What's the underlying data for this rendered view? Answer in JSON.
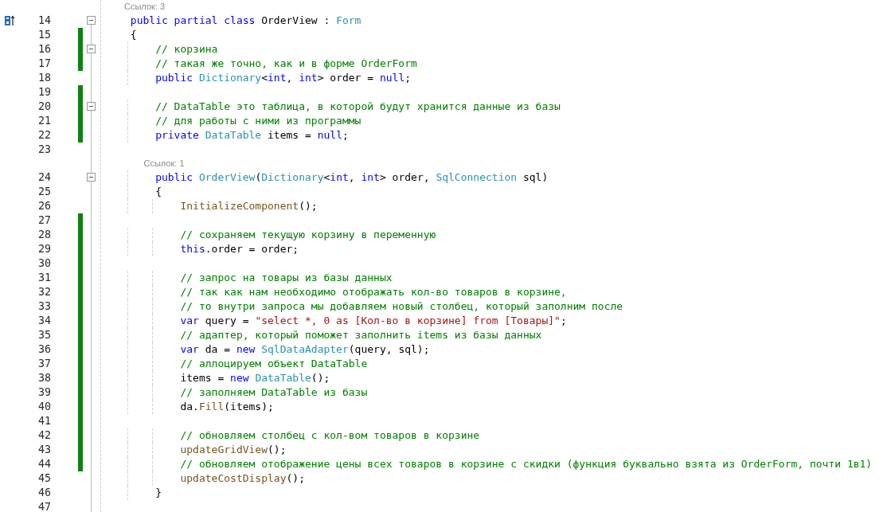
{
  "lines": [
    {
      "n": "14",
      "lens": "Ссылок: 3",
      "glyph": true,
      "fold": true,
      "changed": false,
      "tokens": [
        {
          "t": "public partial class ",
          "kind": "keyword"
        },
        {
          "t": "OrderView : ",
          "kind": "plain"
        },
        {
          "t": "Form",
          "kind": "type"
        }
      ]
    },
    {
      "n": "15",
      "glyph": false,
      "fold": false,
      "changed": true,
      "tokens": [
        {
          "t": "{",
          "kind": "plain"
        }
      ]
    },
    {
      "n": "16",
      "glyph": false,
      "fold": true,
      "changed": true,
      "tokens": [
        {
          "t": "    // корзина",
          "kind": "comment"
        }
      ]
    },
    {
      "n": "17",
      "glyph": false,
      "fold": false,
      "changed": true,
      "tokens": [
        {
          "t": "    // такая же точно, как и в форме OrderForm",
          "kind": "comment"
        }
      ]
    },
    {
      "n": "18",
      "glyph": false,
      "fold": false,
      "changed": false,
      "tokens": [
        {
          "t": "    public ",
          "kind": "keyword"
        },
        {
          "t": "Dictionary",
          "kind": "type"
        },
        {
          "t": "<",
          "kind": "plain"
        },
        {
          "t": "int",
          "kind": "keyword"
        },
        {
          "t": ", ",
          "kind": "plain"
        },
        {
          "t": "int",
          "kind": "keyword"
        },
        {
          "t": "> order = ",
          "kind": "plain"
        },
        {
          "t": "null",
          "kind": "keyword"
        },
        {
          "t": ";",
          "kind": "plain"
        }
      ]
    },
    {
      "n": "19",
      "glyph": false,
      "fold": false,
      "changed": true
    },
    {
      "n": "20",
      "glyph": false,
      "fold": true,
      "changed": true,
      "tokens": [
        {
          "t": "    // DataTable это таблица, в которой будут хранится данные из базы",
          "kind": "comment"
        }
      ]
    },
    {
      "n": "21",
      "glyph": false,
      "fold": false,
      "changed": true,
      "tokens": [
        {
          "t": "    // для работы с ними из программы",
          "kind": "comment"
        }
      ]
    },
    {
      "n": "22",
      "glyph": false,
      "fold": false,
      "changed": true,
      "tokens": [
        {
          "t": "    private ",
          "kind": "keyword"
        },
        {
          "t": "DataTable",
          "kind": "type"
        },
        {
          "t": " items = ",
          "kind": "plain"
        },
        {
          "t": "null",
          "kind": "keyword"
        },
        {
          "t": ";",
          "kind": "plain"
        }
      ]
    },
    {
      "n": "23",
      "glyph": false,
      "fold": false,
      "changed": false
    },
    {
      "n": "24",
      "lens": "Ссылок: 1",
      "glyph": false,
      "fold": true,
      "changed": false,
      "tokens": [
        {
          "t": "    public ",
          "kind": "keyword"
        },
        {
          "t": "OrderView",
          "kind": "type"
        },
        {
          "t": "(",
          "kind": "plain"
        },
        {
          "t": "Dictionary",
          "kind": "type"
        },
        {
          "t": "<",
          "kind": "plain"
        },
        {
          "t": "int",
          "kind": "keyword"
        },
        {
          "t": ", ",
          "kind": "plain"
        },
        {
          "t": "int",
          "kind": "keyword"
        },
        {
          "t": "> order, ",
          "kind": "plain"
        },
        {
          "t": "SqlConnection",
          "kind": "type"
        },
        {
          "t": " sql)",
          "kind": "plain"
        }
      ]
    },
    {
      "n": "25",
      "glyph": false,
      "fold": false,
      "changed": false,
      "tokens": [
        {
          "t": "    {",
          "kind": "plain"
        }
      ]
    },
    {
      "n": "26",
      "glyph": false,
      "fold": false,
      "changed": false,
      "tokens": [
        {
          "t": "        InitializeComponent",
          "kind": "method"
        },
        {
          "t": "();",
          "kind": "plain"
        }
      ]
    },
    {
      "n": "27",
      "glyph": false,
      "fold": false,
      "changed": true
    },
    {
      "n": "28",
      "glyph": false,
      "fold": false,
      "changed": true,
      "tokens": [
        {
          "t": "        // сохраняем текущую корзину в переменную",
          "kind": "comment"
        }
      ]
    },
    {
      "n": "29",
      "glyph": false,
      "fold": false,
      "changed": true,
      "tokens": [
        {
          "t": "        this",
          "kind": "keyword"
        },
        {
          "t": ".order = order;",
          "kind": "plain"
        }
      ]
    },
    {
      "n": "30",
      "glyph": false,
      "fold": false,
      "changed": true
    },
    {
      "n": "31",
      "glyph": false,
      "fold": false,
      "changed": true,
      "tokens": [
        {
          "t": "        // запрос на товары из базы данных",
          "kind": "comment"
        }
      ]
    },
    {
      "n": "32",
      "glyph": false,
      "fold": false,
      "changed": true,
      "tokens": [
        {
          "t": "        // так как нам необходимо отображать кол-во товаров в корзине,",
          "kind": "comment"
        }
      ]
    },
    {
      "n": "33",
      "glyph": false,
      "fold": false,
      "changed": true,
      "tokens": [
        {
          "t": "        // то внутри запроса мы добавляем новый столбец, который заполним после",
          "kind": "comment"
        }
      ]
    },
    {
      "n": "34",
      "glyph": false,
      "fold": false,
      "changed": true,
      "tokens": [
        {
          "t": "        var ",
          "kind": "keyword"
        },
        {
          "t": "query = ",
          "kind": "plain"
        },
        {
          "t": "\"select *, 0 as [Кол-во в корзине] from [Товары]\"",
          "kind": "string"
        },
        {
          "t": ";",
          "kind": "plain"
        }
      ]
    },
    {
      "n": "35",
      "glyph": false,
      "fold": false,
      "changed": true,
      "tokens": [
        {
          "t": "        // адаптер, который поможет заполнить items из базы данных",
          "kind": "comment"
        }
      ]
    },
    {
      "n": "36",
      "glyph": false,
      "fold": false,
      "changed": true,
      "tokens": [
        {
          "t": "        var ",
          "kind": "keyword"
        },
        {
          "t": "da = ",
          "kind": "plain"
        },
        {
          "t": "new ",
          "kind": "keyword"
        },
        {
          "t": "SqlDataAdapter",
          "kind": "type"
        },
        {
          "t": "(query, sql);",
          "kind": "plain"
        }
      ]
    },
    {
      "n": "37",
      "glyph": false,
      "fold": false,
      "changed": true,
      "tokens": [
        {
          "t": "        // аллоцируем объект DataTable",
          "kind": "comment"
        }
      ]
    },
    {
      "n": "38",
      "glyph": false,
      "fold": false,
      "changed": true,
      "tokens": [
        {
          "t": "        items = ",
          "kind": "plain"
        },
        {
          "t": "new ",
          "kind": "keyword"
        },
        {
          "t": "DataTable",
          "kind": "type"
        },
        {
          "t": "();",
          "kind": "plain"
        }
      ]
    },
    {
      "n": "39",
      "glyph": false,
      "fold": false,
      "changed": true,
      "tokens": [
        {
          "t": "        // заполняем DataTable из базы",
          "kind": "comment"
        }
      ]
    },
    {
      "n": "40",
      "glyph": false,
      "fold": false,
      "changed": true,
      "tokens": [
        {
          "t": "        da.",
          "kind": "plain"
        },
        {
          "t": "Fill",
          "kind": "method"
        },
        {
          "t": "(items);",
          "kind": "plain"
        }
      ]
    },
    {
      "n": "41",
      "glyph": false,
      "fold": false,
      "changed": true
    },
    {
      "n": "42",
      "glyph": false,
      "fold": false,
      "changed": true,
      "tokens": [
        {
          "t": "        // обновляем столбец с кол-вом товаров в корзине",
          "kind": "comment"
        }
      ]
    },
    {
      "n": "43",
      "glyph": false,
      "fold": false,
      "changed": true,
      "tokens": [
        {
          "t": "        updateGridView",
          "kind": "method"
        },
        {
          "t": "();",
          "kind": "plain"
        }
      ]
    },
    {
      "n": "44",
      "glyph": false,
      "fold": false,
      "changed": true,
      "tokens": [
        {
          "t": "        // обновляем отображение цены всех товаров в корзине с скидки (функция буквально взята из OrderForm, почти 1в1)",
          "kind": "comment"
        }
      ]
    },
    {
      "n": "45",
      "glyph": false,
      "fold": false,
      "changed": false,
      "tokens": [
        {
          "t": "        updateCostDisplay",
          "kind": "method"
        },
        {
          "t": "();",
          "kind": "plain"
        }
      ]
    },
    {
      "n": "46",
      "glyph": false,
      "fold": false,
      "changed": false,
      "tokens": [
        {
          "t": "    }",
          "kind": "plain"
        }
      ]
    },
    {
      "n": "47",
      "glyph": false,
      "fold": false,
      "changed": false
    }
  ]
}
